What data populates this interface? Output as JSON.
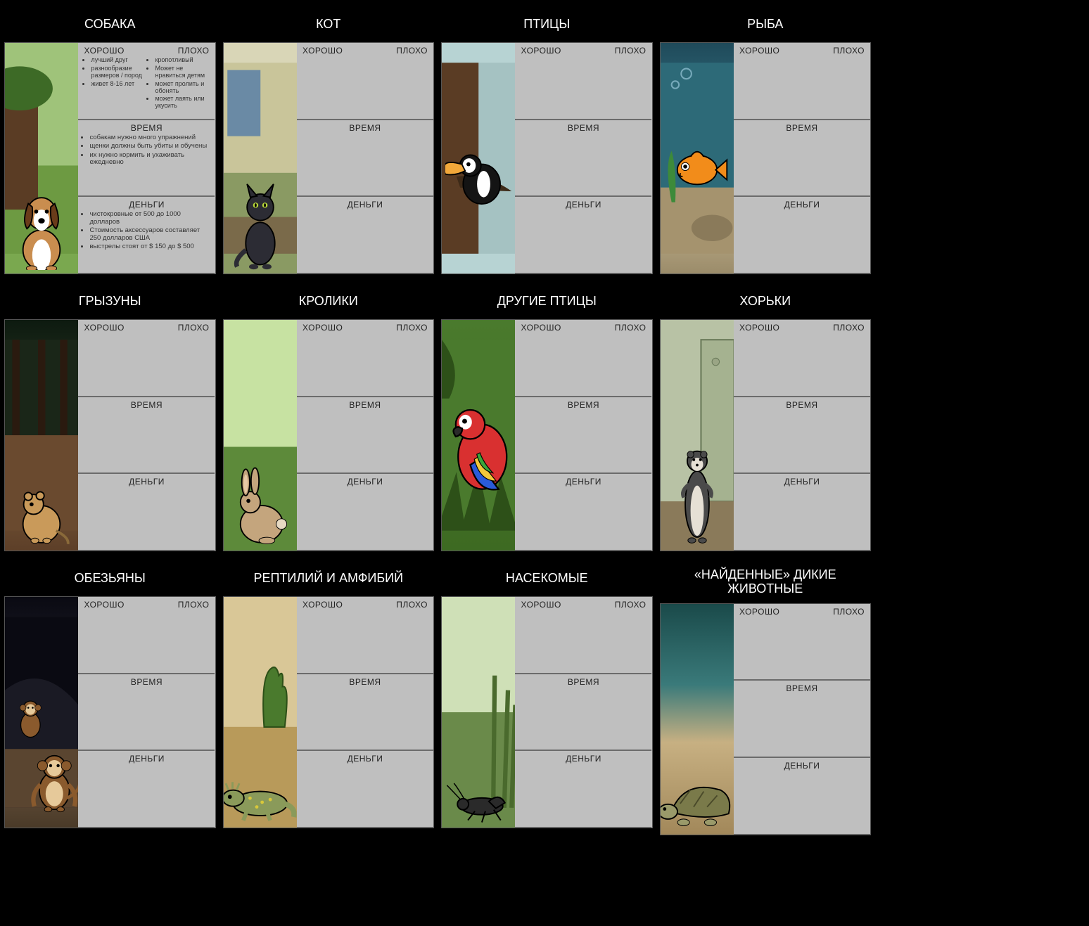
{
  "labels": {
    "good": "ХОРОШО",
    "bad": "ПЛОХО",
    "time": "ВРЕМЯ",
    "money": "ДЕНЬГИ"
  },
  "cells": [
    {
      "title": "СОБАКА",
      "good": [
        "лучший друг",
        "разнообразие размеров / пород",
        "живет 8-16 лет"
      ],
      "bad": [
        "кропотливый",
        "Может не нравиться детям",
        "может пролить и обонять",
        "может лаять или укусить"
      ],
      "time": [
        "собакам нужно много упражнений",
        "щенки должны быть убиты и обучены",
        "их нужно кормить и ухаживать ежедневно"
      ],
      "money": [
        "чистокровные от 500 до 1000 долларов",
        "Стоимость аксессуаров составляет 250 долларов США",
        "выстрелы стоят от $ 150 до $ 500"
      ]
    },
    {
      "title": "КОТ"
    },
    {
      "title": "ПТИЦЫ"
    },
    {
      "title": "РЫБА"
    },
    {
      "title": "ГРЫЗУНЫ"
    },
    {
      "title": "КРОЛИКИ"
    },
    {
      "title": "ДРУГИЕ ПТИЦЫ"
    },
    {
      "title": "ХОРЬКИ"
    },
    {
      "title": "ОБЕЗЬЯНЫ"
    },
    {
      "title": "РЕПТИЛИЙ И АМФИБИЙ"
    },
    {
      "title": "НАСЕКОМЫЕ"
    },
    {
      "title": "«НАЙДЕННЫЕ» ДИКИЕ ЖИВОТНЫЕ"
    }
  ]
}
